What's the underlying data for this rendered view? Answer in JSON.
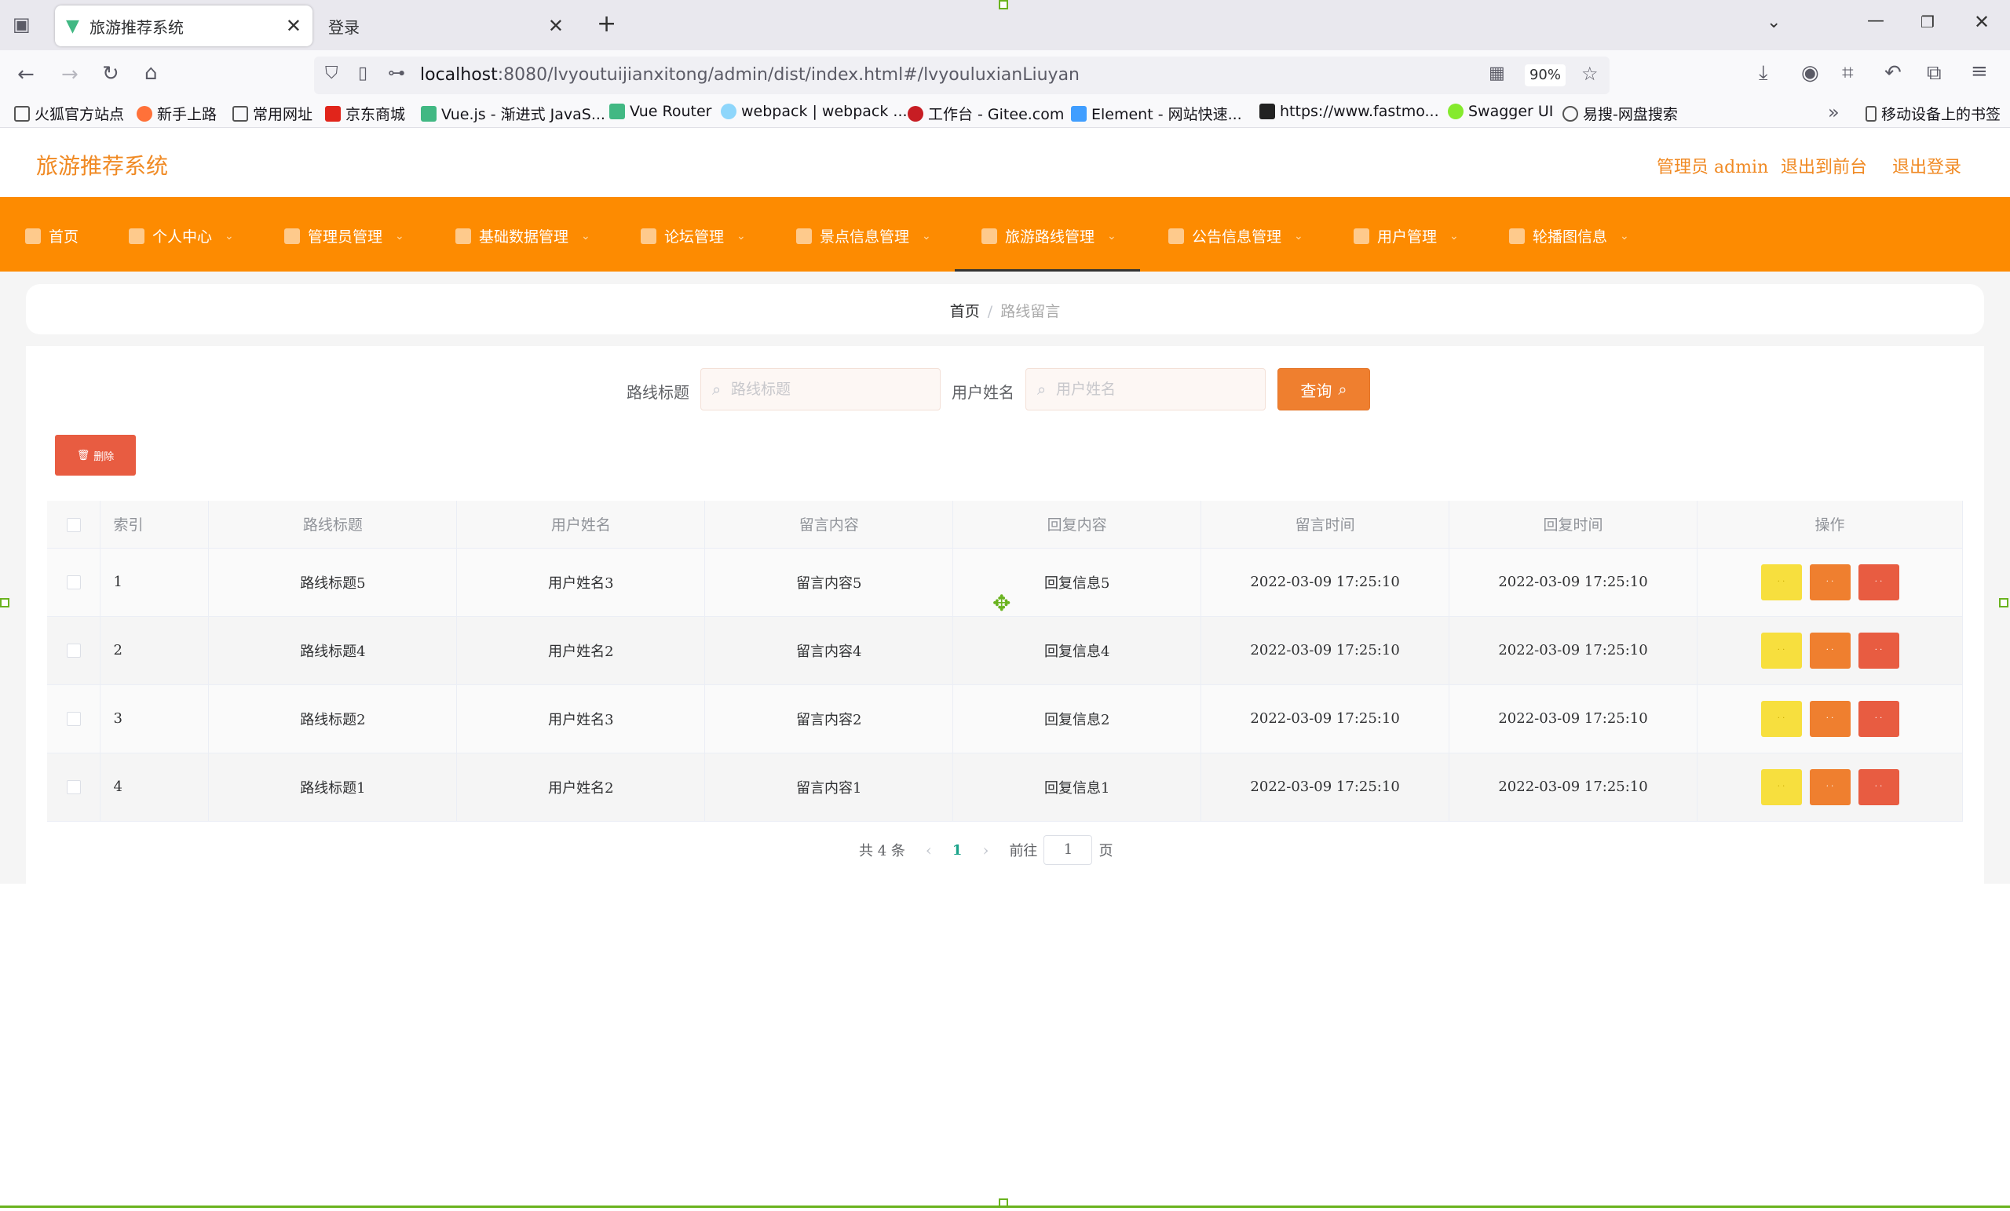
{
  "browser": {
    "tabs": [
      {
        "title": "旅游推荐系统",
        "active": true
      },
      {
        "title": "登录",
        "active": false
      }
    ],
    "url_host": "localhost",
    "url_rest": ":8080/lvyoutuijianxitong/admin/dist/index.html#/lvyouluxianLiuyan",
    "zoom": "90%",
    "bookmarks": [
      {
        "label": "火狐官方站点",
        "color": "#ffffff"
      },
      {
        "label": "新手上路",
        "color": "#ff7139"
      },
      {
        "label": "常用网址",
        "color": "#ffffff"
      },
      {
        "label": "京东商城",
        "color": "#e1251b"
      },
      {
        "label": "Vue.js - 渐进式 JavaS...",
        "color": "#41b883"
      },
      {
        "label": "Vue Router",
        "color": "#41b883"
      },
      {
        "label": "webpack | webpack ...",
        "color": "#8ed6fb"
      },
      {
        "label": "工作台 - Gitee.com",
        "color": "#c71d23"
      },
      {
        "label": "Element - 网站快速...",
        "color": "#409eff"
      },
      {
        "label": "https://www.fastmo...",
        "color": "#222222"
      },
      {
        "label": "Swagger UI",
        "color": "#85ea2d"
      },
      {
        "label": "易搜-网盘搜索",
        "color": "#ffffff"
      }
    ],
    "mobile_bookmarks": "移动设备上的书签"
  },
  "app": {
    "title": "旅游推荐系统",
    "header_links": [
      "管理员 admin",
      "退出到前台",
      "退出登录"
    ],
    "accent": "#fd8b01",
    "menu": [
      {
        "label": "首页",
        "icon": "home-icon",
        "has_chevron": false
      },
      {
        "label": "个人中心",
        "icon": "user-icon",
        "has_chevron": true
      },
      {
        "label": "管理员管理",
        "icon": "admin-icon",
        "has_chevron": true
      },
      {
        "label": "基础数据管理",
        "icon": "data-icon",
        "has_chevron": true
      },
      {
        "label": "论坛管理",
        "icon": "forum-icon",
        "has_chevron": true
      },
      {
        "label": "景点信息管理",
        "icon": "location-icon",
        "has_chevron": true
      },
      {
        "label": "旅游路线管理",
        "icon": "route-icon",
        "has_chevron": true,
        "active": true
      },
      {
        "label": "公告信息管理",
        "icon": "notice-icon",
        "has_chevron": true
      },
      {
        "label": "用户管理",
        "icon": "users-icon",
        "has_chevron": true
      },
      {
        "label": "轮播图信息",
        "icon": "carousel-icon",
        "has_chevron": true
      }
    ]
  },
  "breadcrumb": {
    "home": "首页",
    "current": "路线留言"
  },
  "filters": {
    "title_label": "路线标题",
    "title_placeholder": "路线标题",
    "user_label": "用户姓名",
    "user_placeholder": "用户姓名",
    "query_button": "查询",
    "delete_button": "删除"
  },
  "table": {
    "columns": [
      "索引",
      "路线标题",
      "用户姓名",
      "留言内容",
      "回复内容",
      "留言时间",
      "回复时间",
      "操作"
    ],
    "rows": [
      {
        "index": "1",
        "title": "路线标题5",
        "user": "用户姓名3",
        "content": "留言内容5",
        "reply": "回复信息5",
        "msg_time": "2022-03-09 17:25:10",
        "reply_time": "2022-03-09 17:25:10"
      },
      {
        "index": "2",
        "title": "路线标题4",
        "user": "用户姓名2",
        "content": "留言内容4",
        "reply": "回复信息4",
        "msg_time": "2022-03-09 17:25:10",
        "reply_time": "2022-03-09 17:25:10"
      },
      {
        "index": "3",
        "title": "路线标题2",
        "user": "用户姓名3",
        "content": "留言内容2",
        "reply": "回复信息2",
        "msg_time": "2022-03-09 17:25:10",
        "reply_time": "2022-03-09 17:25:10"
      },
      {
        "index": "4",
        "title": "路线标题1",
        "user": "用户姓名2",
        "content": "留言内容1",
        "reply": "回复信息1",
        "msg_time": "2022-03-09 17:25:10",
        "reply_time": "2022-03-09 17:25:10"
      }
    ]
  },
  "pagination": {
    "total": "共 4 条",
    "current_page": "1",
    "goto_label": "前往",
    "goto_value": "1",
    "page_suffix": "页"
  }
}
